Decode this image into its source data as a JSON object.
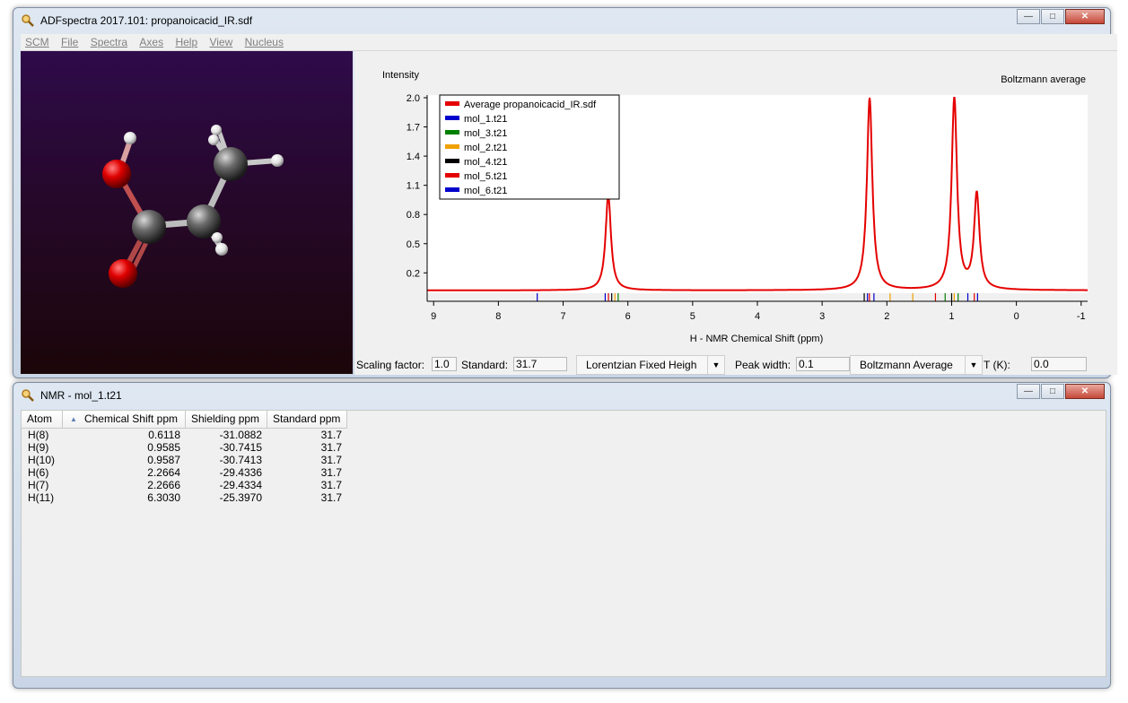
{
  "main_window": {
    "title": "ADFspectra 2017.101: propanoicacid_IR.sdf",
    "menu": [
      "SCM",
      "File",
      "Spectra",
      "Axes",
      "Help",
      "View",
      "Nucleus"
    ]
  },
  "plot": {
    "ylabel": "Intensity",
    "average_label": "Boltzmann average",
    "xlabel": "H - NMR Chemical Shift (ppm)",
    "y_ticks": [
      "2.0",
      "1.7",
      "1.4",
      "1.1",
      "0.8",
      "0.5",
      "0.2"
    ],
    "x_ticks": [
      "9",
      "8",
      "7",
      "6",
      "5",
      "4",
      "3",
      "2",
      "1",
      "0",
      "-1"
    ],
    "legend": [
      {
        "label": "Average propanoicacid_IR.sdf",
        "color": "#e50000"
      },
      {
        "label": "mol_1.t21",
        "color": "#0000cc"
      },
      {
        "label": "mol_3.t21",
        "color": "#008000"
      },
      {
        "label": "mol_2.t21",
        "color": "#f0a000"
      },
      {
        "label": "mol_4.t21",
        "color": "#000000"
      },
      {
        "label": "mol_5.t21",
        "color": "#e50000"
      },
      {
        "label": "mol_6.t21",
        "color": "#0000cc"
      }
    ]
  },
  "chart_data": {
    "type": "line",
    "xlabel": "H - NMR Chemical Shift (ppm)",
    "ylabel": "Intensity",
    "xlim": [
      9.1,
      -1.1
    ],
    "ylim": [
      0.0,
      2.0
    ],
    "x_reversed": true,
    "lorentzian_width_ppm": 0.1,
    "baseline": 0.02,
    "series": [
      {
        "name": "Average propanoicacid_IR.sdf",
        "color": "#e50000",
        "peaks": [
          {
            "x": 6.303,
            "height": 1.0
          },
          {
            "x": 2.2665,
            "height": 2.0
          },
          {
            "x": 0.9586,
            "height": 2.0
          },
          {
            "x": 0.6118,
            "height": 1.0
          }
        ]
      }
    ],
    "stick_marks": [
      {
        "x": 7.4,
        "color": "#0000cc"
      },
      {
        "x": 6.35,
        "color": "#0000cc"
      },
      {
        "x": 6.3,
        "color": "#e50000"
      },
      {
        "x": 6.25,
        "color": "#000000"
      },
      {
        "x": 6.2,
        "color": "#f0a000"
      },
      {
        "x": 6.15,
        "color": "#008000"
      },
      {
        "x": 2.35,
        "color": "#000000"
      },
      {
        "x": 2.3,
        "color": "#0000cc"
      },
      {
        "x": 2.27,
        "color": "#e50000"
      },
      {
        "x": 2.2,
        "color": "#0000cc"
      },
      {
        "x": 1.95,
        "color": "#f0a000"
      },
      {
        "x": 1.6,
        "color": "#f0a000"
      },
      {
        "x": 1.25,
        "color": "#e50000"
      },
      {
        "x": 1.1,
        "color": "#008000"
      },
      {
        "x": 1.0,
        "color": "#000000"
      },
      {
        "x": 0.96,
        "color": "#f0a000"
      },
      {
        "x": 0.9,
        "color": "#008000"
      },
      {
        "x": 0.75,
        "color": "#0000cc"
      },
      {
        "x": 0.65,
        "color": "#e50000"
      },
      {
        "x": 0.6,
        "color": "#0000cc"
      }
    ]
  },
  "controls": {
    "scaling_label": "Scaling factor:",
    "scaling_value": "1.0",
    "standard_label": "Standard:",
    "standard_value": "31.7",
    "lineshape": "Lorentzian Fixed Heigh",
    "peak_width_label": "Peak width:",
    "peak_width_value": "0.1",
    "averaging": "Boltzmann Average",
    "temp_label": "T (K):",
    "temp_value": "0.0"
  },
  "nmr_window": {
    "title": "NMR - mol_1.t21",
    "columns": [
      "Atom",
      "Chemical Shift ppm",
      "Shielding ppm",
      "Standard ppm"
    ],
    "rows": [
      [
        "H(8)",
        "0.6118",
        "-31.0882",
        "31.7"
      ],
      [
        "H(9)",
        "0.9585",
        "-30.7415",
        "31.7"
      ],
      [
        "H(10)",
        "0.9587",
        "-30.7413",
        "31.7"
      ],
      [
        "H(6)",
        "2.2664",
        "-29.4336",
        "31.7"
      ],
      [
        "H(7)",
        "2.2666",
        "-29.4334",
        "31.7"
      ],
      [
        "H(11)",
        "6.3030",
        "-25.3970",
        "31.7"
      ]
    ]
  }
}
